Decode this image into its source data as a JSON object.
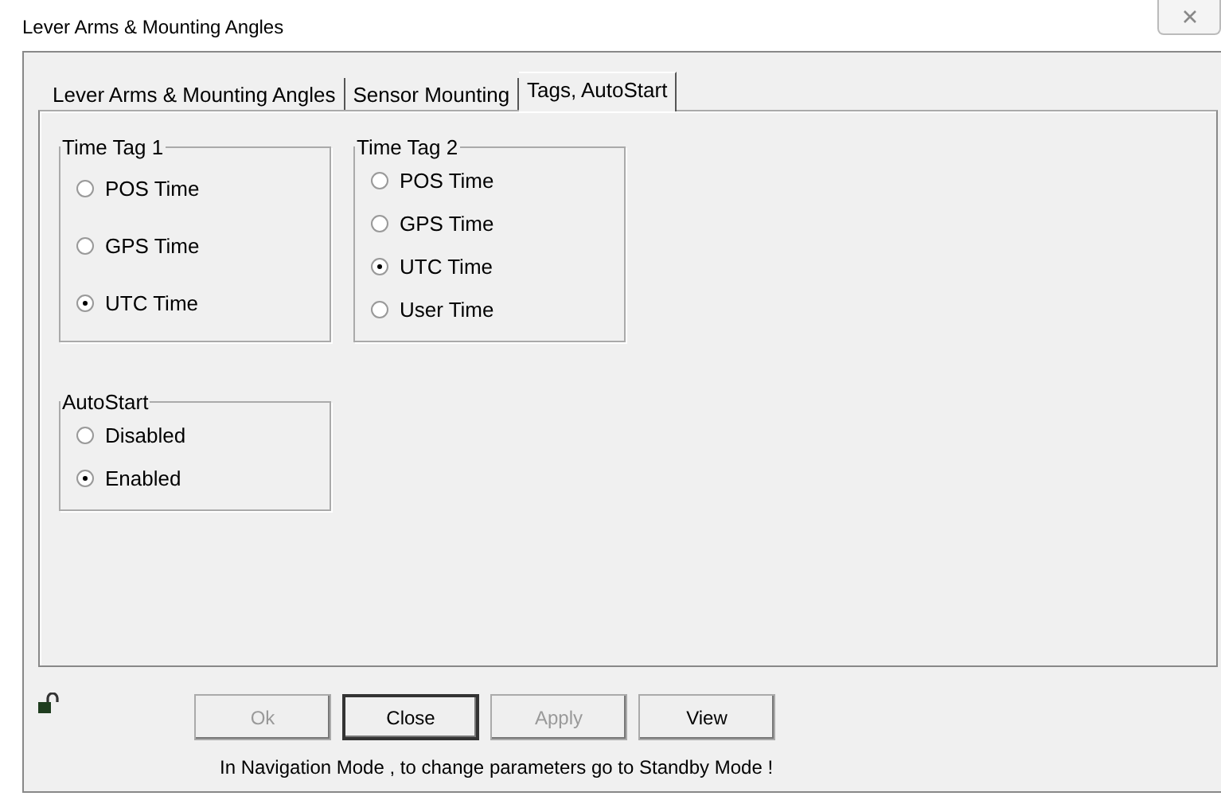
{
  "window": {
    "title": "Lever Arms & Mounting Angles"
  },
  "tabs": [
    {
      "label": "Lever Arms & Mounting Angles",
      "selected": false
    },
    {
      "label": "Sensor Mounting",
      "selected": false
    },
    {
      "label": "Tags, AutoStart",
      "selected": true
    }
  ],
  "groups": [
    {
      "title": "Time Tag 1",
      "options": [
        {
          "label": "POS Time",
          "selected": false
        },
        {
          "label": "GPS Time",
          "selected": false
        },
        {
          "label": "UTC Time",
          "selected": true
        }
      ]
    },
    {
      "title": "Time Tag 2",
      "options": [
        {
          "label": "POS Time",
          "selected": false
        },
        {
          "label": "GPS Time",
          "selected": false
        },
        {
          "label": "UTC Time",
          "selected": true
        },
        {
          "label": "User Time",
          "selected": false
        }
      ]
    },
    {
      "title": "AutoStart",
      "options": [
        {
          "label": "Disabled",
          "selected": false
        },
        {
          "label": "Enabled",
          "selected": true
        }
      ]
    }
  ],
  "buttons": [
    {
      "label": "Ok",
      "disabled": true,
      "default": false
    },
    {
      "label": "Close",
      "disabled": false,
      "default": true
    },
    {
      "label": "Apply",
      "disabled": true,
      "default": false
    },
    {
      "label": "View",
      "disabled": false,
      "default": false
    }
  ],
  "status_message": "In Navigation Mode , to change parameters go to Standby Mode !"
}
